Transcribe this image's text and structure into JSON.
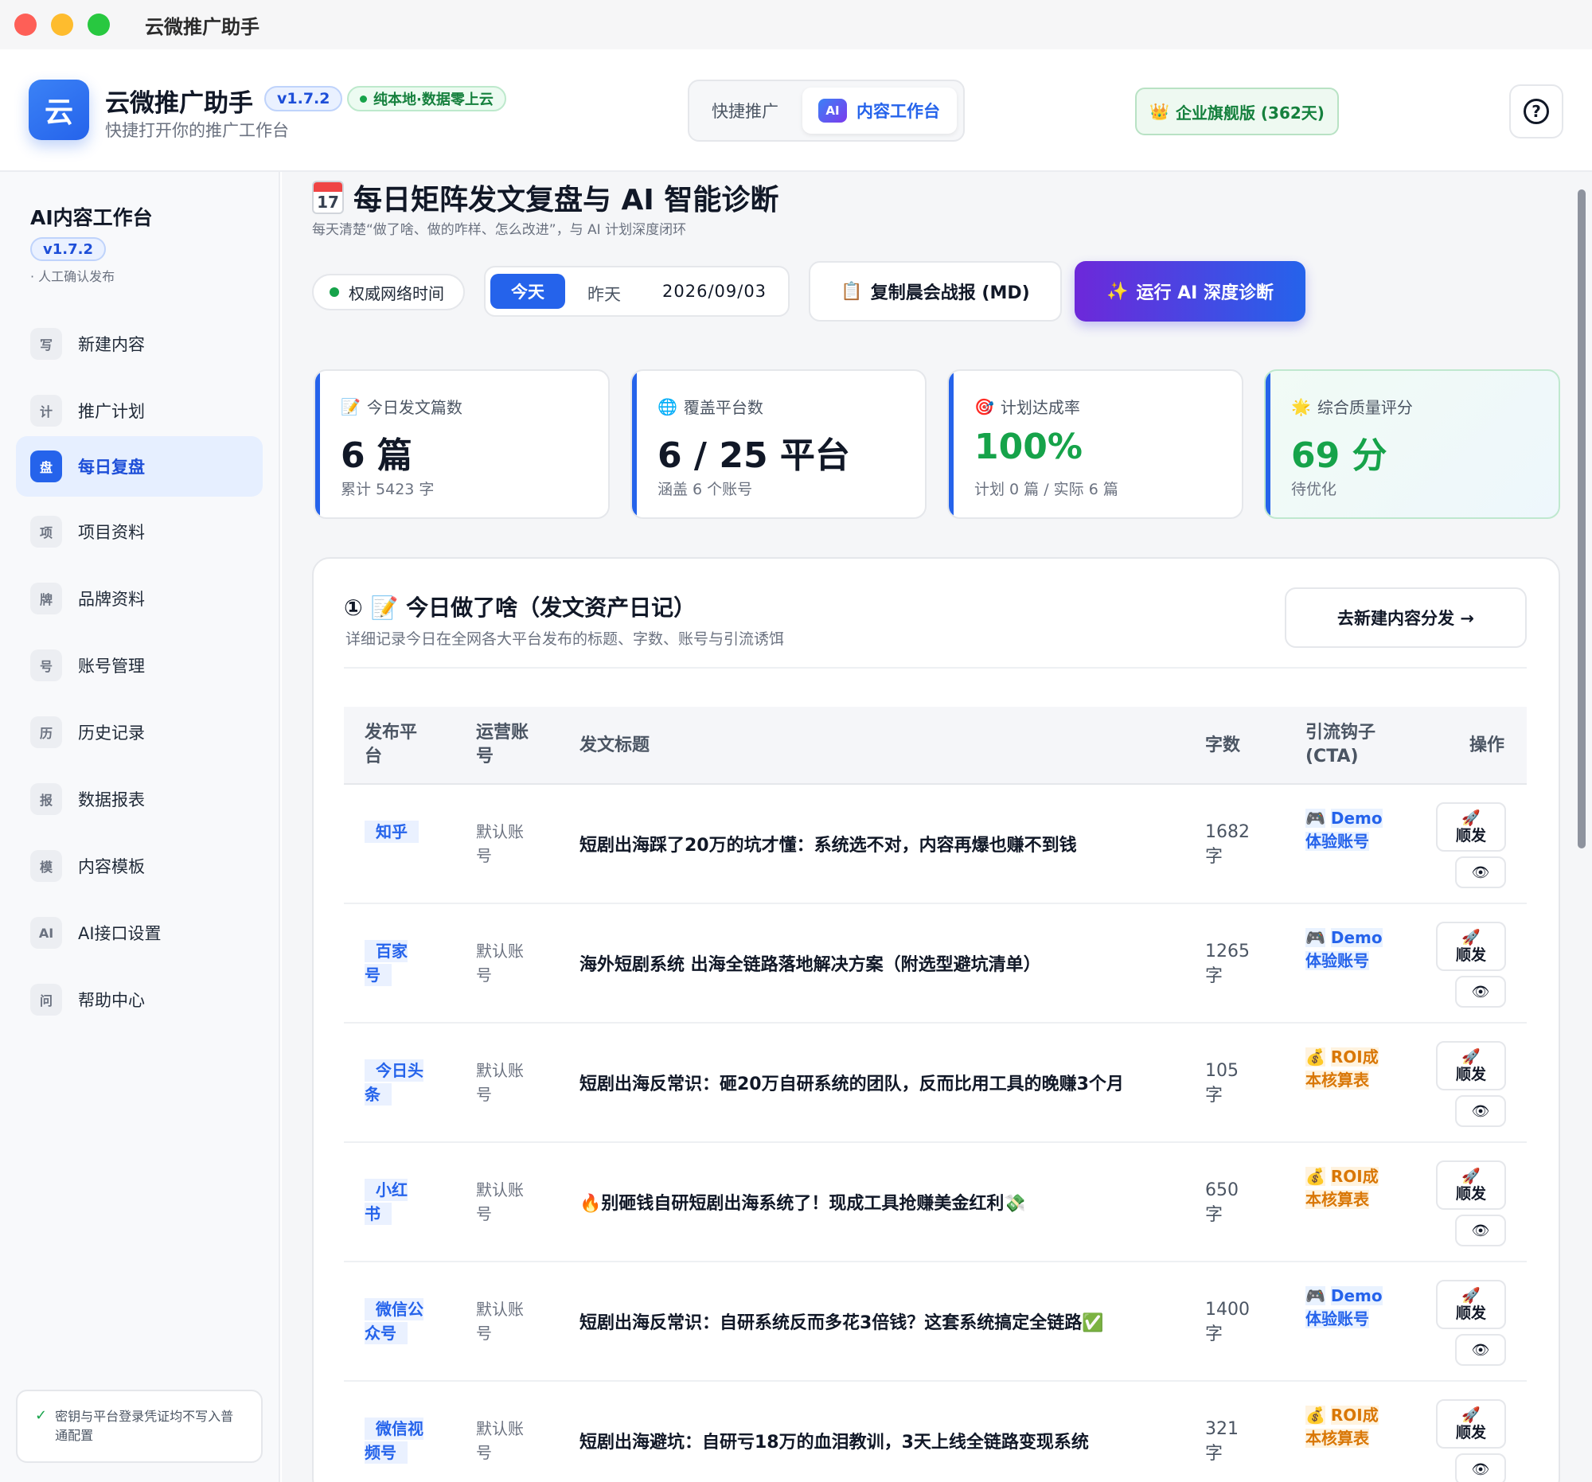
{
  "window": {
    "title": "云微推广助手"
  },
  "header": {
    "logo_char": "云",
    "app_name": "云微推广助手",
    "app_sub": "快捷打开你的推广工作台",
    "version": "v1.7.2",
    "local_badge": "纯本地·数据零上云",
    "mode_quick": "快捷推广",
    "mode_ai_badge": "AI",
    "mode_ai": "内容工作台",
    "vip": "企业旗舰版 (362天)"
  },
  "sidebar": {
    "title": "AI内容工作台",
    "version": "v1.7.2",
    "note": "· 人工确认发布",
    "items": [
      {
        "icon": "写",
        "label": "新建内容"
      },
      {
        "icon": "计",
        "label": "推广计划"
      },
      {
        "icon": "盘",
        "label": "每日复盘"
      },
      {
        "icon": "项",
        "label": "项目资料"
      },
      {
        "icon": "牌",
        "label": "品牌资料"
      },
      {
        "icon": "号",
        "label": "账号管理"
      },
      {
        "icon": "历",
        "label": "历史记录"
      },
      {
        "icon": "报",
        "label": "数据报表"
      },
      {
        "icon": "模",
        "label": "内容模板"
      },
      {
        "icon": "AI",
        "label": "AI接口设置"
      },
      {
        "icon": "问",
        "label": "帮助中心"
      }
    ],
    "active_index": 2,
    "footer_check": "✓",
    "footer_note": "密钥与平台登录凭证均不写入普通配置"
  },
  "page": {
    "calendar_num": "17",
    "title": "每日矩阵发文复盘与 AI 智能诊断",
    "subtitle": "每天清楚“做了啥、做的咋样、怎么改进”，与 AI 计划深度闭环",
    "time_label": "权威网络时间",
    "today": "今天",
    "yesterday": "昨天",
    "date": "2026/09/03",
    "copy_btn": "复制晨会战报 (MD)",
    "ai_btn": "运行 AI 深度诊断"
  },
  "stats": [
    {
      "icon": "📝",
      "label": "今日发文篇数",
      "value": "6 篇",
      "sub": "累计 5423 字"
    },
    {
      "icon": "🌐",
      "label": "覆盖平台数",
      "value": "6 / 25 平台",
      "sub": "涵盖 6 个账号"
    },
    {
      "icon": "🎯",
      "label": "计划达成率",
      "value": "100%",
      "sub": "计划 0 篇 / 实际 6 篇"
    },
    {
      "icon": "🌟",
      "label": "综合质量评分",
      "value": "69 分",
      "sub": "待优化"
    }
  ],
  "section": {
    "title": "① 📝 今日做了啥（发文资产日记）",
    "subtitle": "详细记录今日在全网各大平台发布的标题、字数、账号与引流诱饵",
    "go_btn": "去新建内容分发 →"
  },
  "table": {
    "headers": [
      "发布平台",
      "运营账号",
      "发文标题",
      "字数",
      "引流钩子 (CTA)",
      "操作"
    ],
    "send_label": "顺发",
    "rows": [
      {
        "platform": "知乎",
        "account": "默认账号",
        "title": "短剧出海踩了20万的坑才懂：系统选不对，内容再爆也赚不到钱",
        "words": "1682 字",
        "cta_icon": "🎮",
        "cta": "Demo体验账号",
        "cta_color": "blue"
      },
      {
        "platform": "百家号",
        "account": "默认账号",
        "title": "海外短剧系统 出海全链路落地解决方案（附选型避坑清单）",
        "words": "1265 字",
        "cta_icon": "🎮",
        "cta": "Demo体验账号",
        "cta_color": "blue"
      },
      {
        "platform": "今日头条",
        "account": "默认账号",
        "title": "短剧出海反常识：砸20万自研系统的团队，反而比用工具的晚赚3个月",
        "words": "105 字",
        "cta_icon": "💰",
        "cta": "ROI成本核算表",
        "cta_color": "orange"
      },
      {
        "platform": "小红书",
        "account": "默认账号",
        "title": "🔥别砸钱自研短剧出海系统了！现成工具抢赚美金红利💸",
        "words": "650 字",
        "cta_icon": "💰",
        "cta": "ROI成本核算表",
        "cta_color": "orange"
      },
      {
        "platform": "微信公众号",
        "account": "默认账号",
        "title": "短剧出海反常识：自研系统反而多花3倍钱？这套系统搞定全链路✅",
        "words": "1400 字",
        "cta_icon": "🎮",
        "cta": "Demo体验账号",
        "cta_color": "blue"
      },
      {
        "platform": "微信视频号",
        "account": "默认账号",
        "title": "短剧出海避坑：自研亏18万的血泪教训，3天上线全链路变现系统",
        "words": "321 字",
        "cta_icon": "💰",
        "cta": "ROI成本核算表",
        "cta_color": "orange"
      }
    ]
  }
}
